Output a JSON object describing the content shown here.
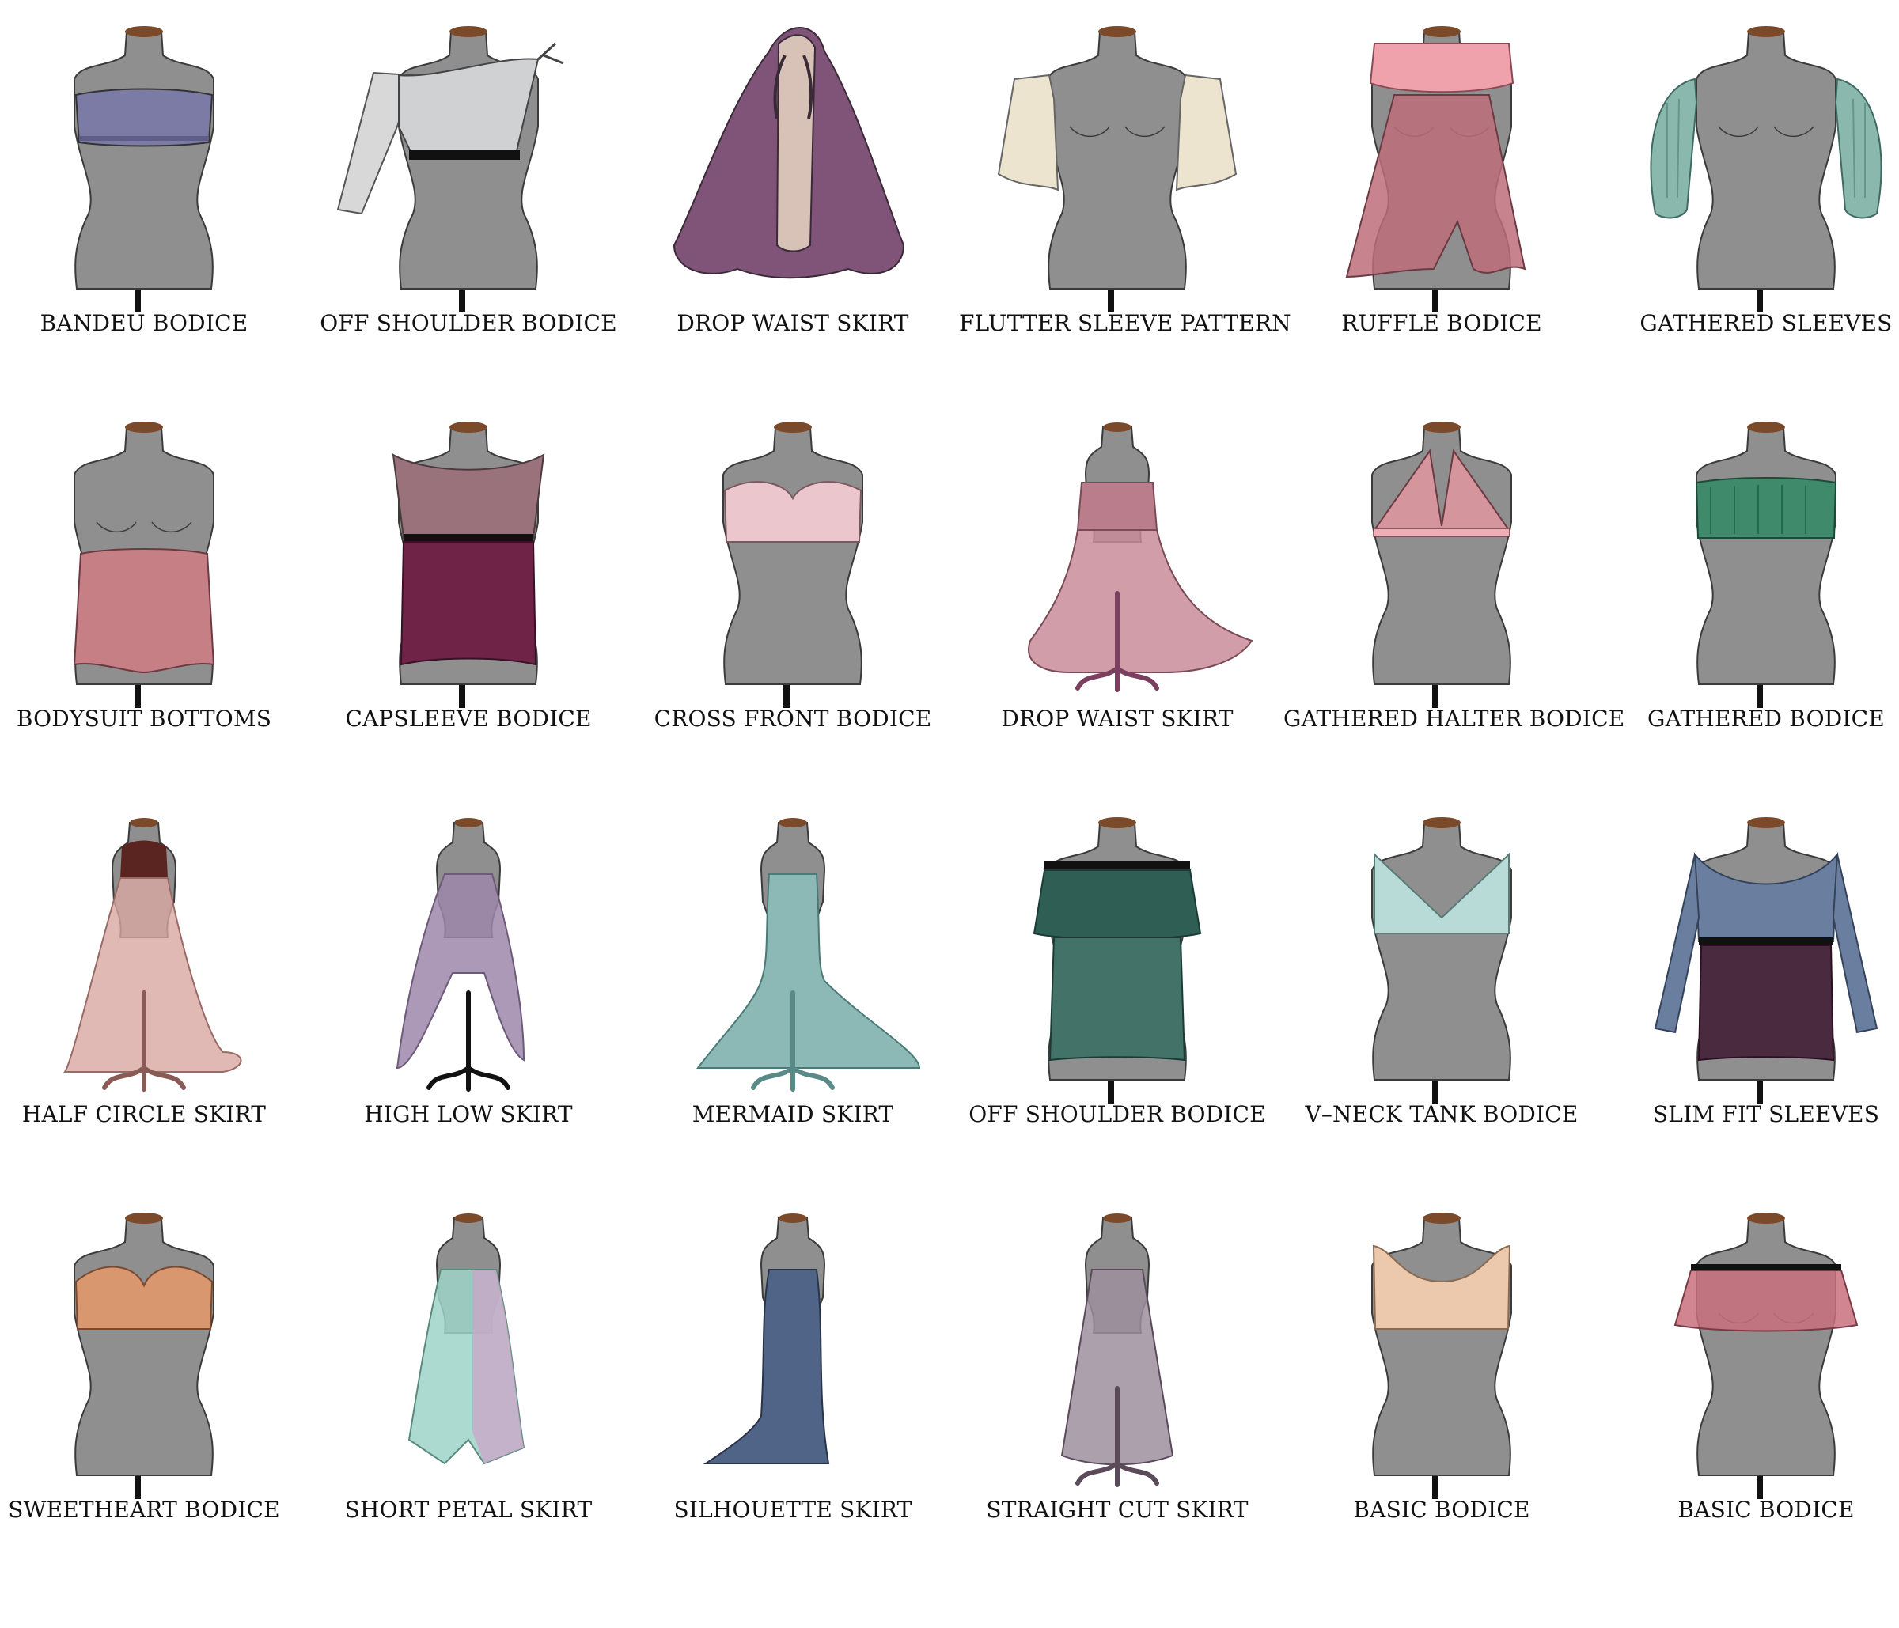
{
  "colors": {
    "mannequin": "#8f8f8f",
    "mannequin_outline": "#3b3b3b",
    "cap": "#7b4a2a",
    "stand": "#111111"
  },
  "garments": [
    {
      "label": "BANDEU BODICE",
      "kind": "bandeau",
      "icon": "bandeau-bodice-icon",
      "color": "#7b7ba6"
    },
    {
      "label": "OFF SHOULDER BODICE",
      "kind": "one-shoulder",
      "icon": "off-shoulder-bodice-icon",
      "color": "#cfd1d3"
    },
    {
      "label": "DROP WAIST SKIRT",
      "kind": "cape",
      "icon": "drop-waist-skirt-icon",
      "color": "#7f5478"
    },
    {
      "label": "FLUTTER SLEEVE PATTERN",
      "kind": "flutter-sleeves",
      "icon": "flutter-sleeve-icon",
      "color": "#ece4cf"
    },
    {
      "label": "RUFFLE BODICE",
      "kind": "ruffle-dress",
      "icon": "ruffle-bodice-icon",
      "color": "#bd6f7a"
    },
    {
      "label": "GATHERED SLEEVES",
      "kind": "gathered-sleeves",
      "icon": "gathered-sleeves-icon",
      "color": "#8ab8ac"
    },
    {
      "label": "BODYSUIT BOTTOMS",
      "kind": "bodysuit",
      "icon": "bodysuit-bottoms-icon",
      "color": "#c67f84"
    },
    {
      "label": "CAPSLEEVE BODICE",
      "kind": "capsleeve",
      "icon": "capsleeve-bodice-icon",
      "color": "#9a727c"
    },
    {
      "label": "CROSS FRONT BODICE",
      "kind": "cross-front",
      "icon": "cross-front-bodice-icon",
      "color": "#ebc6cc"
    },
    {
      "label": "DROP WAIST SKIRT",
      "kind": "drop-waist-gown",
      "icon": "drop-waist-gown-icon",
      "color": "#c98c9a"
    },
    {
      "label": "GATHERED HALTER BODICE",
      "kind": "halter",
      "icon": "gathered-halter-bodice-icon",
      "color": "#d5959c"
    },
    {
      "label": "GATHERED BODICE",
      "kind": "gathered-tube",
      "icon": "gathered-bodice-icon",
      "color": "#3f8a6b"
    },
    {
      "label": "HALF CIRCLE SKIRT",
      "kind": "half-circle",
      "icon": "half-circle-skirt-icon",
      "color": "#d9a7a1"
    },
    {
      "label": "HIGH LOW SKIRT",
      "kind": "high-low",
      "icon": "high-low-skirt-icon",
      "color": "#9e87aa"
    },
    {
      "label": "MERMAID SKIRT",
      "kind": "mermaid",
      "icon": "mermaid-skirt-icon",
      "color": "#8cb9b6"
    },
    {
      "label": "OFF SHOULDER BODICE",
      "kind": "off-shoulder-ruffle",
      "icon": "off-shoulder-ruffle-icon",
      "color": "#2f5e55"
    },
    {
      "label": "V–NECK TANK BODICE",
      "kind": "v-neck",
      "icon": "v-neck-tank-bodice-icon",
      "color": "#b9dbd8"
    },
    {
      "label": "SLIM FIT SLEEVES",
      "kind": "slim-sleeves",
      "icon": "slim-fit-sleeves-icon",
      "color": "#6a7fa0"
    },
    {
      "label": "SWEETHEART BODICE",
      "kind": "sweetheart",
      "icon": "sweetheart-bodice-icon",
      "color": "#d9976f"
    },
    {
      "label": "SHORT PETAL SKIRT",
      "kind": "petal",
      "icon": "short-petal-skirt-icon",
      "color": "#9fd3c8"
    },
    {
      "label": "SILHOUETTE SKIRT",
      "kind": "silhouette",
      "icon": "silhouette-skirt-icon",
      "color": "#4f6486"
    },
    {
      "label": "STRAIGHT CUT SKIRT",
      "kind": "straight",
      "icon": "straight-cut-skirt-icon",
      "color": "#9c8f9c"
    },
    {
      "label": "BASIC BODICE",
      "kind": "basic-crop",
      "icon": "basic-bodice-icon",
      "color": "#ecc9ad"
    },
    {
      "label": "BASIC BODICE",
      "kind": "basic-ruffle",
      "icon": "basic-ruffle-bodice-icon",
      "color": "#c8707c"
    }
  ]
}
